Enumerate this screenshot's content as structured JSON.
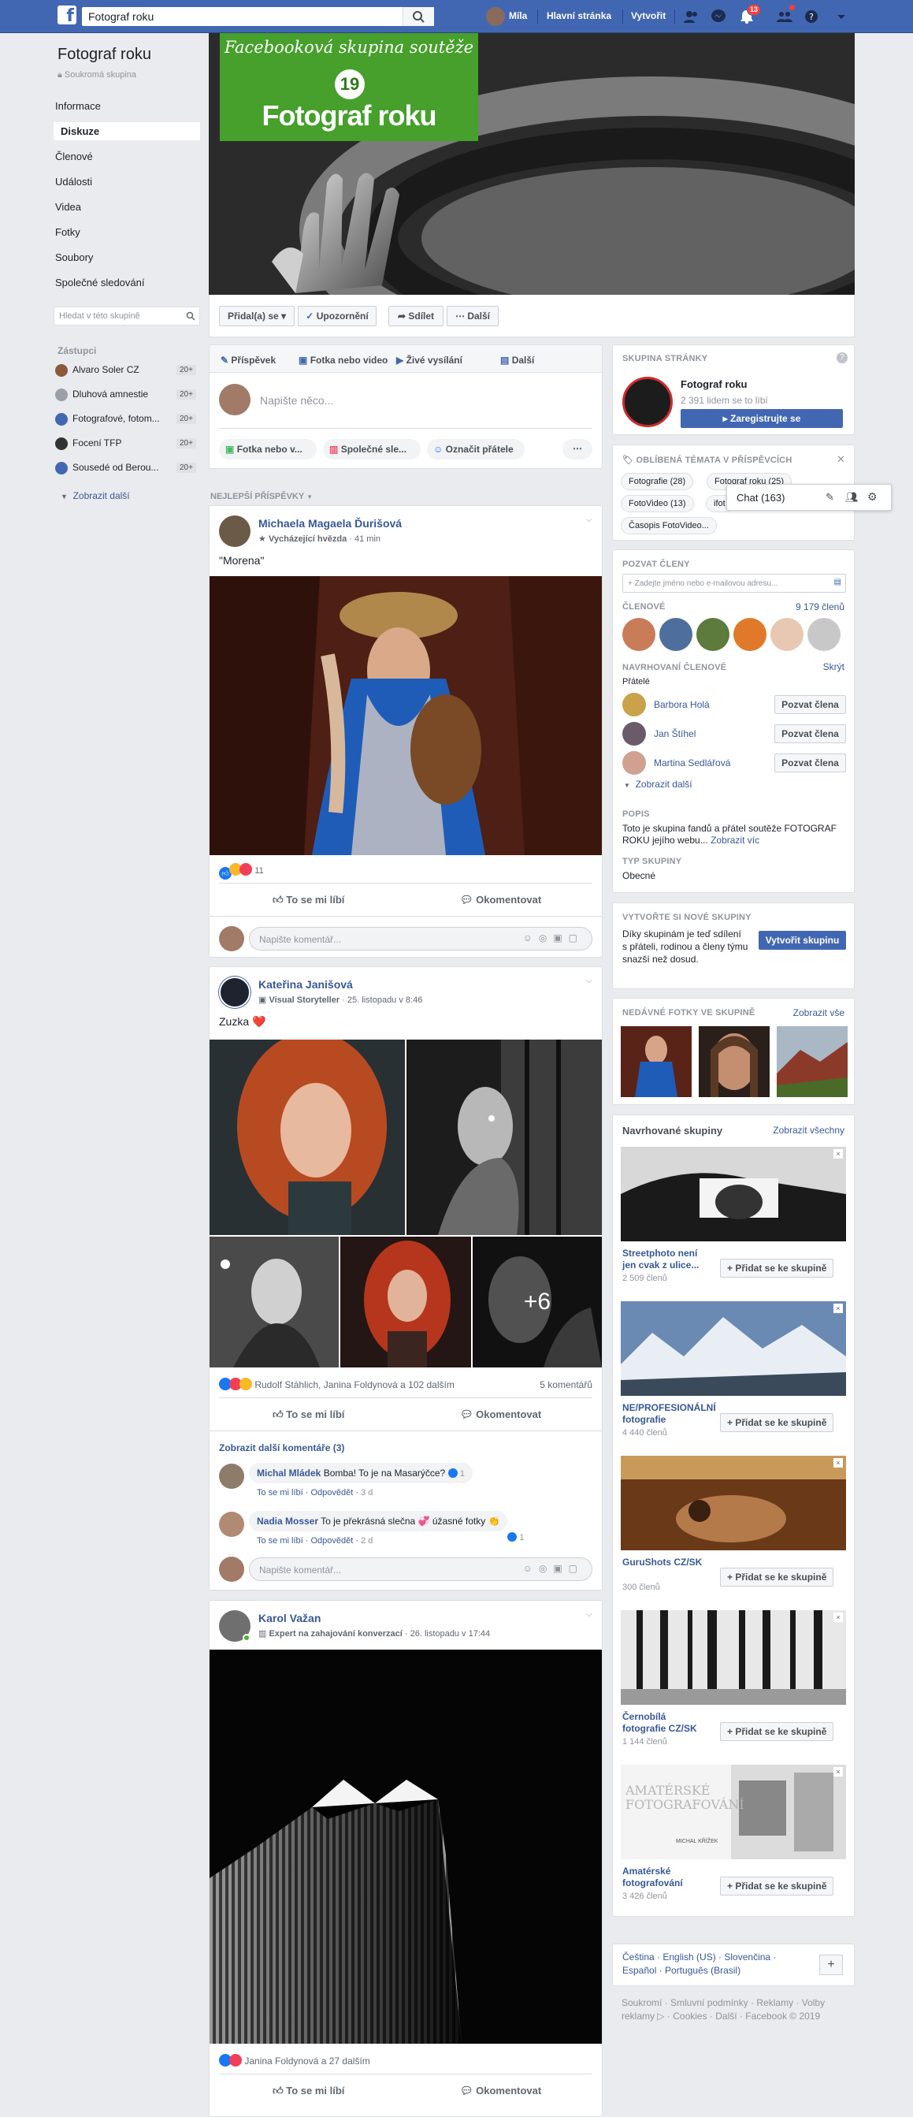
{
  "topbar": {
    "search_value": "Fotograf roku",
    "user_name": "Míla",
    "home": "Hlavní stránka",
    "create": "Vytvořit",
    "notifications_badge": "13"
  },
  "group": {
    "name": "Fotograf roku",
    "privacy": "Soukromá skupina",
    "menu": [
      "Informace",
      "Diskuze",
      "Členové",
      "Události",
      "Videa",
      "Fotky",
      "Soubory",
      "Společné sledování"
    ],
    "active_menu": "Diskuze",
    "search_placeholder": "Hledat v této skupině",
    "cover": {
      "banner_line1": "Facebooková skupina soutěže",
      "badge": "19",
      "banner_line2": "Fotograf roku"
    },
    "cover_buttons": {
      "joined": "Přidal(a) se",
      "notifications": "Upozornění",
      "share": "Sdílet",
      "more": "Další"
    }
  },
  "shortcuts": {
    "title": "Zástupci",
    "items": [
      {
        "label": "Alvaro Soler CZ",
        "count": "20+",
        "color": "#8b5a3c"
      },
      {
        "label": "Dluhová amnestie",
        "count": "20+",
        "color": "#9aa0a8"
      },
      {
        "label": "Fotografové, fotom...",
        "count": "20+",
        "color": "#4267b2"
      },
      {
        "label": "Focení TFP",
        "count": "20+",
        "color": "#333333"
      },
      {
        "label": "Sousedé od Berou...",
        "count": "20+",
        "color": "#4267b2"
      }
    ],
    "more": "Zobrazit další"
  },
  "composer": {
    "tabs": [
      "Příspěvek",
      "Fotka nebo video",
      "Živé vysílání",
      "Další"
    ],
    "placeholder": "Napište něco...",
    "actions": [
      "Fotka nebo v...",
      "Společné sle...",
      "Označit přátele"
    ]
  },
  "feed_header": "NEJLEPŠÍ PŘÍSPĚVKY",
  "posts": [
    {
      "author": "Michaela Magaela Ďurišová",
      "badge": "Vycházející hvězda",
      "time": "41 min",
      "text": "\"Morena\"",
      "reactions": "11",
      "comments_count": "",
      "like": "To se mi líbí",
      "comment": "Okomentovat",
      "comment_placeholder": "Napište komentář..."
    },
    {
      "author": "Kateřina Janišová",
      "badge": "Visual Storyteller",
      "time": "25. listopadu v 8:46",
      "text": "Zuzka ❤️",
      "reactions": "Rudolf Stáhlich, Janina Foldynová a 102 dalším",
      "comments_count": "5 komentářů",
      "like": "To se mi líbí",
      "comment": "Okomentovat",
      "more_photos": "+6",
      "show_more_comments": "Zobrazit další komentáře (3)",
      "comments": [
        {
          "author": "Michal Mládek",
          "text": "Bomba! To je na Masarýčce?",
          "like": "To se mi líbí",
          "reply": "Odpovědět",
          "time": "3 d",
          "reacts": "1"
        },
        {
          "author": "Nadia Mosser",
          "text": "To je překrásná slečna 💞 úžasné fotky 👏",
          "like": "To se mi líbí",
          "reply": "Odpovědět",
          "time": "2 d",
          "reacts": "1"
        }
      ],
      "comment_placeholder": "Napište komentář..."
    },
    {
      "author": "Karol Važan",
      "badge": "Expert na zahajování konverzací",
      "time": "26. listopadu v 17:44",
      "text": "",
      "reactions": "Janina Foldynová a 27 dalším",
      "like": "To se mi líbí",
      "comment": "Okomentovat"
    }
  ],
  "right": {
    "page_card": {
      "title": "SKUPINA STRÁNKY",
      "name": "Fotograf roku",
      "likes": "2 391 lidem se to líbí",
      "register": "Zaregistrujte se"
    },
    "topics": {
      "title": "OBLÍBENÁ TÉMATA V PŘÍSPĚVCÍCH",
      "chips": [
        "Fotografie (28)",
        "Fotograf roku (25)",
        "FotoVideo (13)",
        "ifot",
        "Časopis FotoVideo..."
      ]
    },
    "chat": "Chat (163)",
    "invite": {
      "title": "POZVAT ČLENY",
      "placeholder": "+ Zadejte jméno nebo e-mailovou adresu...",
      "members_label": "ČLENOVÉ",
      "members_count": "9 179 členů",
      "suggested_title": "NAVRHOVANÍ ČLENOVÉ",
      "hide": "Skrýt",
      "friends": "Přátelé",
      "people": [
        {
          "name": "Barbora Holá",
          "btn": "Pozvat člena"
        },
        {
          "name": "Jan Štíhel",
          "btn": "Pozvat člena"
        },
        {
          "name": "Martina Sedlářová",
          "btn": "Pozvat člena"
        }
      ],
      "show_more": "Zobrazit další",
      "desc_title": "POPIS",
      "desc": "Toto je skupina fandů a přátel soutěže FOTOGRAF ROKU jejího webu...",
      "desc_more": "Zobrazit víc",
      "type_title": "TYP SKUPINY",
      "type": "Obecné"
    },
    "create_group": {
      "title": "VYTVOŘTE SI NOVÉ SKUPINY",
      "text": "Díky skupinám je teď sdílení s přáteli, rodinou a členy týmu snazší než dosud.",
      "btn": "Vytvořit skupinu"
    },
    "recent_photos": {
      "title": "NEDÁVNÉ FOTKY VE SKUPINĚ",
      "see_all": "Zobrazit vše"
    },
    "suggested": {
      "title": "Navrhované skupiny",
      "see_all": "Zobrazit všechny",
      "items": [
        {
          "name": "Streetphoto není jen cvak z ulice...",
          "count": "2 509 členů",
          "btn": "+ Přidat se ke skupině"
        },
        {
          "name": "NE/PROFESIONÁLNÍ fotografie",
          "count": "4 440 členů",
          "btn": "+ Přidat se ke skupině"
        },
        {
          "name": "GuruShots CZ/SK",
          "count": "300 členů",
          "btn": "+ Přidat se ke skupině"
        },
        {
          "name": "Černobílá fotografie CZ/SK",
          "count": "1 144 členů",
          "btn": "+ Přidat se ke skupině"
        },
        {
          "name": "Amatérské fotografování",
          "count": "3 426 členů",
          "btn": "+ Přidat se ke skupině"
        }
      ],
      "amateur_overlay": "AMATÉRSKÉ FOTOGRAFOVÁNÍ",
      "amateur_author": "MICHAL KŘÍŽEK"
    },
    "languages": [
      "Čeština",
      "English (US)",
      "Slovenčina",
      "Español",
      "Português (Brasil)"
    ],
    "footer": "Soukromí · Smluvní podmínky · Reklamy · Volby reklamy ▷ · Cookies · Další · Facebook © 2019"
  }
}
